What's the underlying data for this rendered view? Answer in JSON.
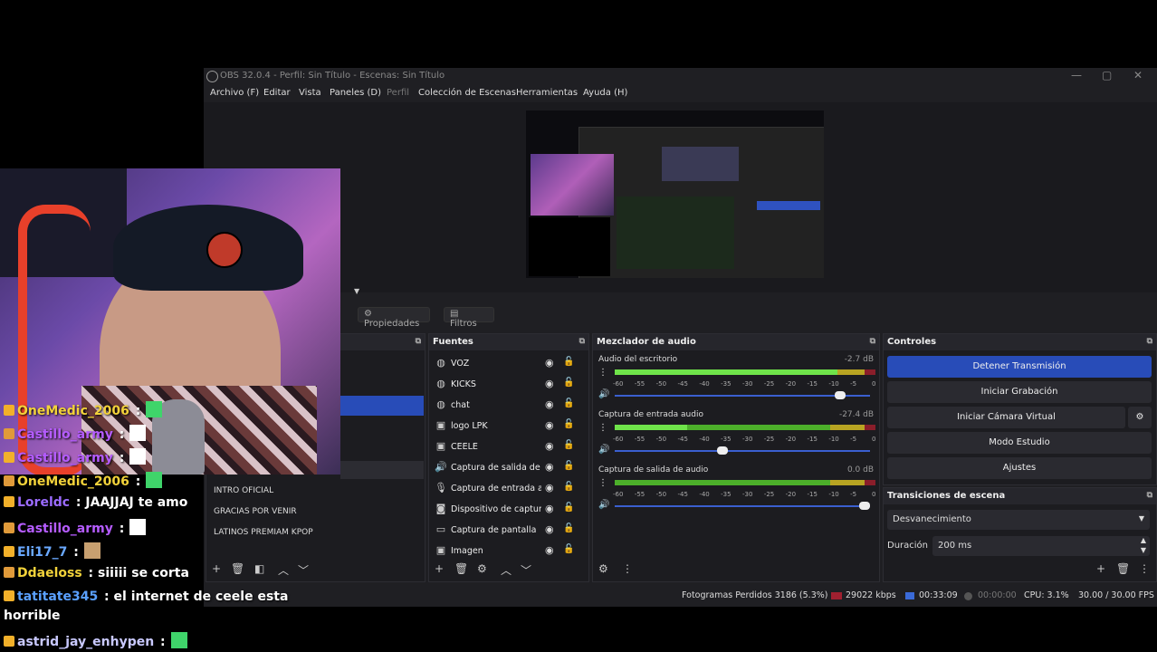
{
  "window": {
    "title": "OBS 32.0.4 - Perfil: Sin Título - Escenas: Sin Título"
  },
  "menu": [
    {
      "label": "Archivo (F)",
      "disabled": false
    },
    {
      "label": "Editar",
      "disabled": false
    },
    {
      "label": "Vista",
      "disabled": false
    },
    {
      "label": "Paneles (D)",
      "disabled": false
    },
    {
      "label": "Perfil",
      "disabled": true
    },
    {
      "label": "Colección de Escenas",
      "disabled": false
    },
    {
      "label": "Herramientas",
      "disabled": false
    },
    {
      "label": "Ayuda (H)",
      "disabled": false
    }
  ],
  "toolbar": {
    "properties": "Propiedades",
    "filters": "Filtros"
  },
  "scenes": {
    "items": [
      "INTRO OFICIAL",
      "GRACIAS POR VENIR",
      "LATINOS PREMIAM KPOP"
    ]
  },
  "sources": {
    "title": "Fuentes",
    "items": [
      {
        "name": "VOZ",
        "icon": "globe-icon"
      },
      {
        "name": "KICKS",
        "icon": "globe-icon"
      },
      {
        "name": "chat",
        "icon": "globe-icon"
      },
      {
        "name": "logo LPK",
        "icon": "image-icon"
      },
      {
        "name": "CEELE",
        "icon": "image-icon"
      },
      {
        "name": "Captura de salida de",
        "icon": "speaker-icon"
      },
      {
        "name": "Captura de entrada a",
        "icon": "mic-icon"
      },
      {
        "name": "Dispositivo de captur",
        "icon": "camera-icon"
      },
      {
        "name": "Captura de pantalla",
        "icon": "monitor-icon"
      },
      {
        "name": "Imagen",
        "icon": "image-icon"
      }
    ]
  },
  "mixer": {
    "title": "Mezclador de audio",
    "scale": [
      "-60",
      "-55",
      "-50",
      "-45",
      "-40",
      "-35",
      "-30",
      "-25",
      "-20",
      "-15",
      "-10",
      "-5",
      "0"
    ],
    "channels": [
      {
        "name": "Audio del escritorio",
        "db": "-2.7 dB",
        "level": 0.86,
        "volume": 0.9
      },
      {
        "name": "Captura de entrada audio",
        "db": "-27.4 dB",
        "level": 0.28,
        "volume": 0.42
      },
      {
        "name": "Captura de salida de audio",
        "db": "0.0 dB",
        "level": 0.0,
        "volume": 1.0
      }
    ]
  },
  "controls": {
    "title": "Controles",
    "stop_stream": "Detener Transmisión",
    "start_rec": "Iniciar Grabación",
    "virtual_cam": "Iniciar Cámara Virtual",
    "studio_mode": "Modo Estudio",
    "settings": "Ajustes"
  },
  "transitions": {
    "title": "Transiciones de escena",
    "selected": "Desvanecimiento",
    "duration_label": "Duración",
    "duration_value": "200 ms"
  },
  "status": {
    "dropped": "Fotogramas Perdidos 3186 (5.3%)",
    "bitrate": "29022 kbps",
    "stream_time": "00:33:09",
    "rec_time": "00:00:00",
    "cpu": "CPU: 3.1%",
    "fps": "30.00 / 30.00 FPS"
  },
  "chat": [
    {
      "user": "OneMedic_2006",
      "sep": " :",
      "msg": "",
      "color": "#f2d23a",
      "emote": "green"
    },
    {
      "user": "Castillo_army",
      "sep": " :",
      "msg": "",
      "color": "#b55cff",
      "emote": "white"
    },
    {
      "user": "Castillo_army",
      "sep": " :",
      "msg": "",
      "color": "#b55cff",
      "emote": "white"
    },
    {
      "user": "OneMedic_2006",
      "sep": " :",
      "msg": "",
      "color": "#f2d23a",
      "emote": "green"
    },
    {
      "user": "Loreldc",
      "sep": " :",
      "msg": " JAAJJAJ te amo",
      "color": "#9b6bff",
      "emote": ""
    },
    {
      "user": "Castillo_army",
      "sep": " :",
      "msg": "",
      "color": "#b55cff",
      "emote": "white"
    },
    {
      "user": "Eli17_7",
      "sep": " :",
      "msg": "",
      "color": "#6aa9ff",
      "emote": "cat"
    },
    {
      "user": "Ddaeloss",
      "sep": " :",
      "msg": " siiiii se corta",
      "color": "#f2d23a",
      "emote": ""
    },
    {
      "user": "tatitate345",
      "sep": " :",
      "msg": " el internet de ceele esta",
      "color": "#5aa0ff",
      "emote": ""
    },
    {
      "user": "",
      "sep": "",
      "msg": "horrible",
      "color": "#ffffff",
      "emote": ""
    },
    {
      "user": "astrid_jay_enhypen",
      "sep": " :",
      "msg": "",
      "color": "#c9c9ff",
      "emote": "green"
    }
  ]
}
